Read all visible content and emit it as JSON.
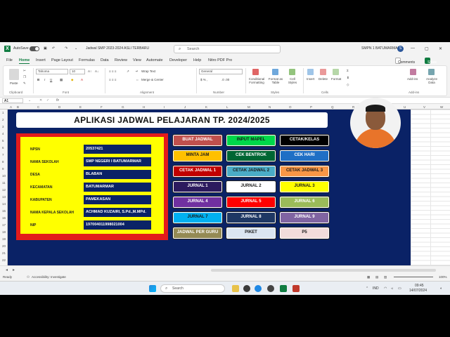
{
  "titlebar": {
    "autosave": "AutoSave",
    "filename": "Jadwal SMP 2023-2024 ASLI TERBARU",
    "search_placeholder": "Search",
    "user": "SMPN 1 BATUMARMAR",
    "user_initial": "S"
  },
  "menu": {
    "tabs": [
      "File",
      "Home",
      "Insert",
      "Page Layout",
      "Formulas",
      "Data",
      "Review",
      "View",
      "Automate",
      "Developer",
      "Help",
      "Nitro PDF Pro"
    ],
    "comments": "Comments",
    "share": "Share"
  },
  "ribbon": {
    "font_name": "Tahoma",
    "font_size": "10",
    "wrap_text": "Wrap Text",
    "merge_center": "Merge & Center",
    "number_format": "General",
    "groups": [
      "Clipboard",
      "Font",
      "Alignment",
      "Number",
      "Styles",
      "Cells",
      "Add-ins"
    ],
    "paste": "Paste",
    "conditional_formatting": "Conditional Formatting",
    "format_as_table": "Format as Table",
    "cell_styles": "Cell Styles",
    "insert": "Insert",
    "delete": "Delete",
    "format": "Format",
    "addins": "Add-ins",
    "analyze_data": "Analyze Data"
  },
  "formula_bar": {
    "cell_ref": "A1",
    "fx": "fx"
  },
  "columns": [
    "A",
    "B",
    "C",
    "D",
    "E",
    "F",
    "G",
    "H",
    "I",
    "J",
    "K",
    "L",
    "M",
    "N",
    "O",
    "P",
    "Q",
    "R",
    "S",
    "T",
    "U",
    "V",
    "W"
  ],
  "rows": [
    "1",
    "2",
    "3",
    "4",
    "5",
    "6",
    "7",
    "8",
    "9",
    "10",
    "11",
    "12",
    "13",
    "14",
    "15",
    "16",
    "17",
    "18",
    "19",
    "20",
    "21",
    "22"
  ],
  "app": {
    "title": "APLIKASI JADWAL PELAJARAN TP. 2024/2025",
    "info": [
      {
        "label": "NPSN",
        "value": "20537421"
      },
      {
        "label": "NAMA SEKOLAH",
        "value": "SMP NEGERI I BATUMARMAR"
      },
      {
        "label": "DESA",
        "value": "BLABAN"
      },
      {
        "label": "KECAMATAN",
        "value": "BATUMARMAR"
      },
      {
        "label": "KABUPATEN",
        "value": "PAMEKASAN"
      },
      {
        "label": "NAMA KEPALA SEKOLAH",
        "value": "ACHMAD KUZAIRI, S.Pd.,M.MPd."
      },
      {
        "label": "NIP",
        "value": "197004011998021004"
      }
    ],
    "buttons": [
      {
        "label": "BUAT JADWAL",
        "bg": "#c0504d",
        "fg": "#ffffff"
      },
      {
        "label": "INPUT MAPEL",
        "bg": "#00d84a",
        "fg": "#1a1a1a"
      },
      {
        "label": "CETAK/KELAS",
        "bg": "#000000",
        "fg": "#ffffff"
      },
      {
        "label": "MINTA JAM",
        "bg": "#ffc000",
        "fg": "#1a1a1a"
      },
      {
        "label": "CEK BENTROK",
        "bg": "#006633",
        "fg": "#ffffff"
      },
      {
        "label": "CEK HARI",
        "bg": "#1f6fc5",
        "fg": "#ffffff"
      },
      {
        "label": "CETAK JADWAL 1",
        "bg": "#c00000",
        "fg": "#ffffff"
      },
      {
        "label": "CETAK JADWAL 2",
        "bg": "#4bacc6",
        "fg": "#1a1a1a"
      },
      {
        "label": "CETAK JADWAL 3",
        "bg": "#f79646",
        "fg": "#1a1a1a"
      },
      {
        "label": "JURNAL 1",
        "bg": "#2c1a5e",
        "fg": "#ffffff"
      },
      {
        "label": "JURNAL 2",
        "bg": "#ffffff",
        "fg": "#1a1a1a"
      },
      {
        "label": "JURNAL 3",
        "bg": "#ffff00",
        "fg": "#1a1a1a"
      },
      {
        "label": "JURNAL 4",
        "bg": "#7030a0",
        "fg": "#ffffff"
      },
      {
        "label": "JURNAL 5",
        "bg": "#ff0000",
        "fg": "#ffffff"
      },
      {
        "label": "JURNAL 6",
        "bg": "#9bbb59",
        "fg": "#ffffff"
      },
      {
        "label": "JURNAL 7",
        "bg": "#00b0f0",
        "fg": "#1a1a1a"
      },
      {
        "label": "JURNAL 8",
        "bg": "#1f3864",
        "fg": "#ffffff"
      },
      {
        "label": "JURNAL 9",
        "bg": "#8064a2",
        "fg": "#ffffff"
      },
      {
        "label": "JADWAL PER GURU",
        "bg": "#948a54",
        "fg": "#ffffff"
      },
      {
        "label": "PIKET",
        "bg": "#dbe5f1",
        "fg": "#1a1a1a"
      },
      {
        "label": "P5",
        "bg": "#f2dcdb",
        "fg": "#1a1a1a"
      }
    ]
  },
  "status": {
    "ready": "Ready",
    "accessibility": "Accessibility: Investigate",
    "zoom": "100%"
  },
  "taskbar": {
    "search": "Search",
    "lang": "IND",
    "time": "09:45",
    "date": "14/07/2024"
  },
  "colors": {
    "board": "#0a2266",
    "panel_border": "#e31b1b",
    "panel_fill": "#ffff00",
    "excel_green": "#107c41"
  }
}
